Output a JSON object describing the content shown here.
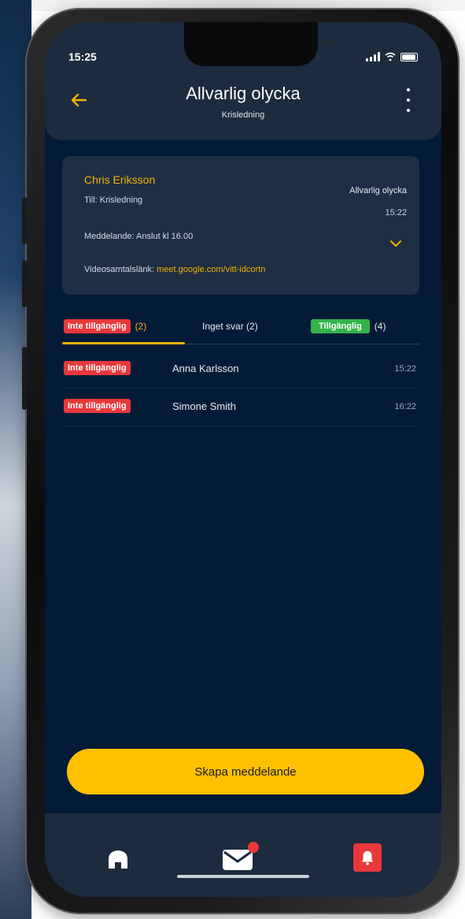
{
  "status_bar": {
    "time": "15:25"
  },
  "header": {
    "title": "Allvarlig olycka",
    "subtitle": "Krisledning"
  },
  "message_card": {
    "sender": "Chris Eriksson",
    "to": "Till: Krisledning",
    "incident": "Allvarlig olycka",
    "time": "15:22",
    "message": "Meddelande: Anslut kl 16.00",
    "video_label": "Videosamtalslänk:",
    "video_link": "meet.google.com/vitt-idcortn"
  },
  "tabs": [
    {
      "badge": "Inte tillgänglig",
      "count": "(2)"
    },
    {
      "label": "Inget svar (2)"
    },
    {
      "badge": "Tillgänglig",
      "count": "(4)"
    }
  ],
  "responses": [
    {
      "status": "Inte tillgänglig",
      "name": "Anna Karlsson",
      "time": "15:22"
    },
    {
      "status": "Inte tillgänglig",
      "name": "Simone Smith",
      "time": "16:22"
    }
  ],
  "cta": {
    "label": "Skapa meddelande"
  },
  "nav": {
    "home_icon": "home-icon",
    "mail_icon": "mail-icon",
    "bell_icon": "bell-icon"
  },
  "colors": {
    "accent": "#f5b301",
    "unavailable": "#e8383a",
    "available": "#35b24c",
    "background": "#041b37"
  }
}
